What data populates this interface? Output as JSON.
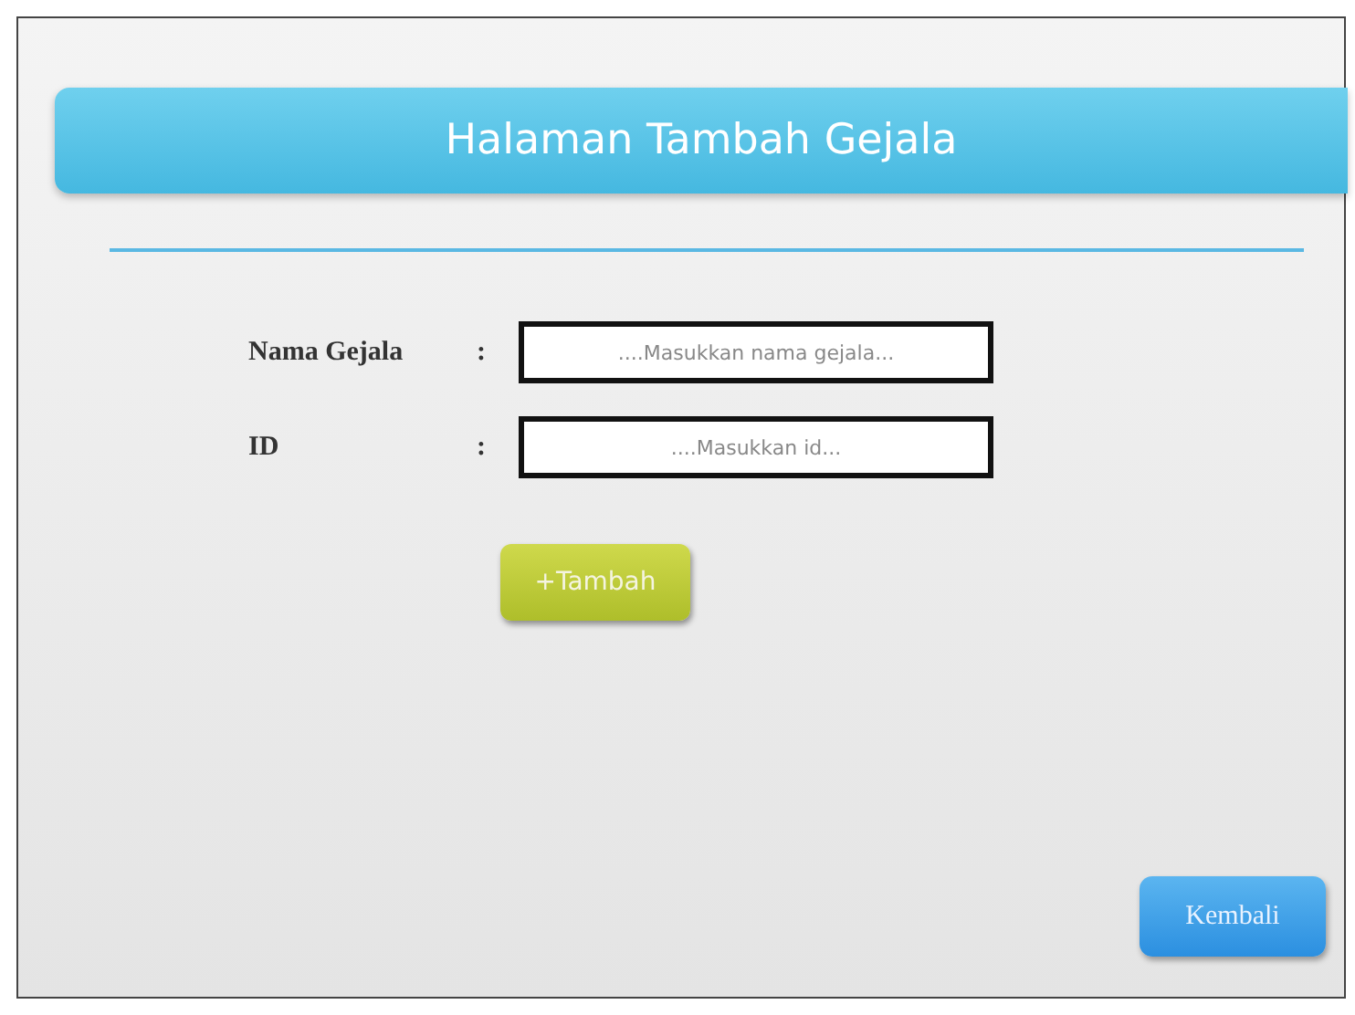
{
  "header": {
    "title": "Halaman Tambah Gejala"
  },
  "form": {
    "fields": [
      {
        "label": "Nama Gejala",
        "separator": ":",
        "placeholder": "....Masukkan nama gejala..."
      },
      {
        "label": "ID",
        "separator": ":",
        "placeholder": "....Masukkan id..."
      }
    ]
  },
  "buttons": [
    {
      "kind": "add",
      "label": "+Tambah"
    },
    {
      "kind": "back",
      "label": "Kembali"
    }
  ]
}
